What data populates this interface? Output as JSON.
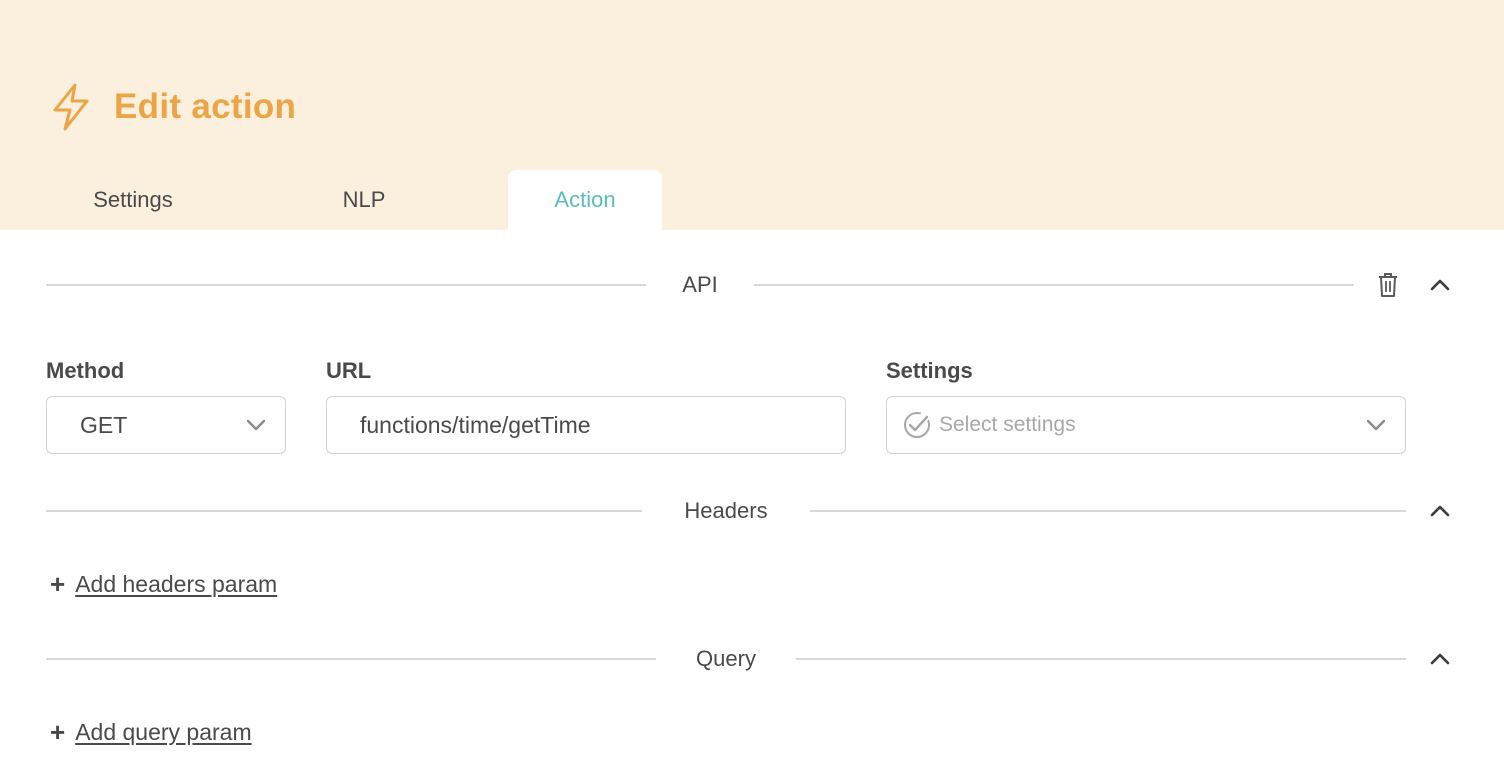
{
  "header": {
    "title": "Edit action",
    "icon": "lightning-bolt-icon"
  },
  "tabs": [
    {
      "label": "Settings",
      "active": false
    },
    {
      "label": "NLP",
      "active": false
    },
    {
      "label": "Action",
      "active": true
    }
  ],
  "colors": {
    "header_bg": "#fbefdd",
    "title": "#eba546",
    "active_tab": "#5cbcbc",
    "text": "#4a4a4a"
  },
  "api_section": {
    "title": "API",
    "delete_icon": "trash-icon",
    "collapse_icon": "chevron-up-icon"
  },
  "form": {
    "method": {
      "label": "Method",
      "value": "GET"
    },
    "url": {
      "label": "URL",
      "value": "functions/time/getTime"
    },
    "settings": {
      "label": "Settings",
      "placeholder": "Select settings",
      "icon": "check-badge-icon"
    }
  },
  "headers_section": {
    "title": "Headers",
    "add_label": "Add headers param"
  },
  "query_section": {
    "title": "Query",
    "add_label": "Add query param"
  }
}
